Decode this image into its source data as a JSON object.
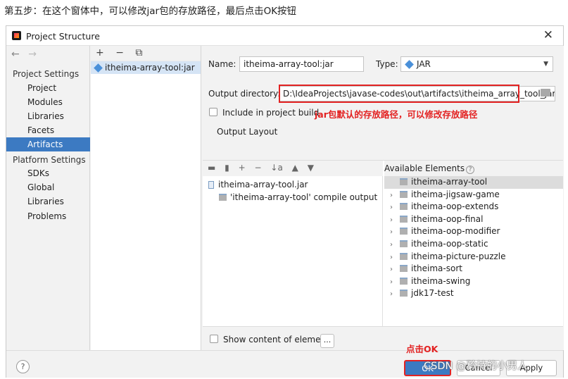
{
  "caption": "第五步：在这个窗体中，可以修改jar包的存放路径，最后点击OK按钮",
  "window": {
    "title": "Project Structure",
    "close_glyph": "✕"
  },
  "nav": {
    "back": "←",
    "forward": "→"
  },
  "sidebar": {
    "project_settings_header": "Project Settings",
    "project_items": [
      {
        "label": "Project"
      },
      {
        "label": "Modules"
      },
      {
        "label": "Libraries"
      },
      {
        "label": "Facets"
      },
      {
        "label": "Artifacts",
        "selected": true
      }
    ],
    "platform_settings_header": "Platform Settings",
    "platform_items": [
      {
        "label": "SDKs"
      },
      {
        "label": "Global Libraries"
      }
    ],
    "problems_label": "Problems"
  },
  "artifacts_list": {
    "toolbar": {
      "add": "+",
      "remove": "−",
      "copy": "⧉"
    },
    "items": [
      {
        "label": "itheima-array-tool:jar",
        "icon": "artifact-jar-icon",
        "selected": true
      }
    ]
  },
  "form": {
    "name_label": "Name:",
    "name_value": "itheima-array-tool:jar",
    "type_label": "Type:",
    "type_value": "JAR",
    "output_dir_label": "Output directory:",
    "output_dir_value": "D:\\IdeaProjects\\javase-codes\\out\\artifacts\\itheima_array_tool_jar",
    "include_in_build_label": "Include in project build",
    "include_in_build_checked": false,
    "output_dir_annotation": "jar包默认的存放路径，可以修改存放路径",
    "output_layout_tab": "Output Layout"
  },
  "layout_toolbar": {
    "new_dir": "▬",
    "add_file": "▮",
    "add": "+",
    "remove": "−",
    "sort": "↓a",
    "up": "▲",
    "down": "▼"
  },
  "layout_tree": [
    {
      "label": "itheima-array-tool.jar",
      "icon": "jar-file-icon"
    },
    {
      "label": "'itheima-array-tool' compile output",
      "icon": "module-output-icon"
    }
  ],
  "available_elements": {
    "header": "Available Elements",
    "items": [
      {
        "label": "itheima-array-tool",
        "expandable": false,
        "selected": true
      },
      {
        "label": "itheima-jigsaw-game",
        "expandable": true
      },
      {
        "label": "itheima-oop-extends",
        "expandable": true
      },
      {
        "label": "itheima-oop-final",
        "expandable": true
      },
      {
        "label": "itheima-oop-modifier",
        "expandable": true
      },
      {
        "label": "itheima-oop-static",
        "expandable": true
      },
      {
        "label": "itheima-picture-puzzle",
        "expandable": true
      },
      {
        "label": "itheima-sort",
        "expandable": true
      },
      {
        "label": "itheima-swing",
        "expandable": true
      },
      {
        "label": "jdk17-test",
        "expandable": true
      }
    ]
  },
  "show_content": {
    "label": "Show content of elements",
    "checked": false,
    "button": "..."
  },
  "footer": {
    "help": "?",
    "ok": "OK",
    "cancel": "Cancel",
    "apply": "Apply",
    "ok_annotation": "点击OK"
  },
  "watermark": "CSDN @矜持的小男人",
  "colors": {
    "accent": "#3c7ac2",
    "annotation": "#e32222",
    "selection_light": "#d5e4f5"
  }
}
